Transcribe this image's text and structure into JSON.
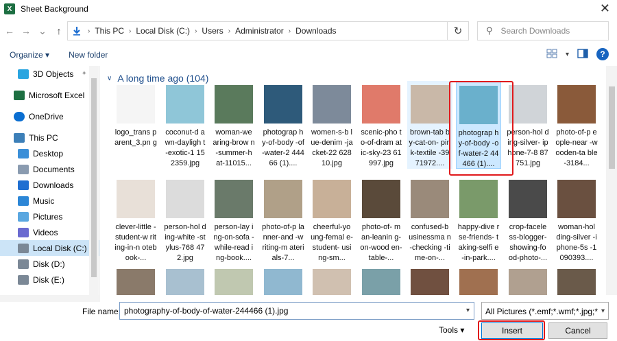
{
  "window": {
    "title": "Sheet Background",
    "app_icon_letter": "X",
    "close_glyph": "✕"
  },
  "nav": {
    "back_glyph": "←",
    "forward_glyph": "→",
    "recent_glyph": "⌄",
    "up_glyph": "↑",
    "breadcrumbs": [
      "This PC",
      "Local Disk (C:)",
      "Users",
      "Administrator",
      "Downloads"
    ],
    "search_placeholder": "Search Downloads",
    "refresh_glyph": "↻"
  },
  "toolbar": {
    "organize_label": "Organize ▾",
    "new_folder_label": "New folder",
    "help_glyph": "?"
  },
  "sidebar": {
    "items": [
      {
        "label": "3D Objects",
        "icon": "cube-icon",
        "color": "#2aa5e0",
        "pinned": true
      },
      {
        "label": "Microsoft Excel",
        "icon": "excel-icon",
        "color": "#1d6f42",
        "root": true
      },
      {
        "label": "OneDrive",
        "icon": "cloud-icon",
        "color": "#0a6ed1",
        "root": true
      },
      {
        "label": "This PC",
        "icon": "computer-icon",
        "color": "#3c7fb8",
        "root": true
      },
      {
        "label": "Desktop",
        "icon": "desktop-icon",
        "color": "#3b8fd8"
      },
      {
        "label": "Documents",
        "icon": "documents-icon",
        "color": "#8a9bb0"
      },
      {
        "label": "Downloads",
        "icon": "downloads-icon",
        "color": "#1f6fd1"
      },
      {
        "label": "Music",
        "icon": "music-icon",
        "color": "#2c86d6"
      },
      {
        "label": "Pictures",
        "icon": "pictures-icon",
        "color": "#5aa7e0"
      },
      {
        "label": "Videos",
        "icon": "videos-icon",
        "color": "#6a6ad0"
      },
      {
        "label": "Local Disk (C:)",
        "icon": "drive-icon",
        "color": "#7b8896",
        "selected": true
      },
      {
        "label": "Disk (D:)",
        "icon": "drive-icon",
        "color": "#7b8896"
      },
      {
        "label": "Disk (E:)",
        "icon": "drive-icon",
        "color": "#7b8896"
      }
    ],
    "pin_glyph": "📌"
  },
  "group": {
    "title": "A long time ago (104)",
    "chevron": "∨"
  },
  "files": {
    "row1": [
      {
        "label": "logo_trans parent_3.pn g",
        "thumb": "#f5f5f5"
      },
      {
        "label": "coconut-d awn-dayligh t-exotic-1 152359.jpg",
        "thumb": "#8fc6d8"
      },
      {
        "label": "woman-we aring-brow n-summer-h at-11015...",
        "thumb": "#5a7a5c"
      },
      {
        "label": "photograp hy-of-body -of-water-2 44466 (1)....",
        "thumb": "#2e5a7a"
      },
      {
        "label": "women-s-b lue-denim -jacket-22 62810.jpg",
        "thumb": "#7d8a9a"
      },
      {
        "label": "scenic-pho to-of-dram atic-sky-23 61997.jpg",
        "thumb": "#e07a6a"
      },
      {
        "label": "brown-tab by-cat-on- pink-textile -3971972....",
        "thumb": "#c9b8a8",
        "selected_bg": true
      },
      {
        "label": "photograp hy-of-body -of-water-2 44466 (1)....",
        "thumb": "#6ab0cc",
        "selected": true
      },
      {
        "label": "person-hol ding-silver- iphone-7-8 87751.jpg",
        "thumb": "#d0d4d8"
      },
      {
        "label": "photo-of-p eople-near -wooden-ta ble-3184...",
        "thumb": "#8a5a3a"
      }
    ],
    "row2": [
      {
        "label": "clever-little -student-w riting-in-n otebook-...",
        "thumb": "#e8e0d8"
      },
      {
        "label": "person-hol ding-white -stylus-768 472.jpg",
        "thumb": "#dcdcdc"
      },
      {
        "label": "person-lay ing-on-sofa -while-read ing-book....",
        "thumb": "#6a7a6a"
      },
      {
        "label": "photo-of-p lanner-and -writing-m aterials-7...",
        "thumb": "#b0a088"
      },
      {
        "label": "cheerful-yo ung-femal e-student- using-sm...",
        "thumb": "#c8b098"
      },
      {
        "label": "photo-of- man-leanin g-on-wood en-table-...",
        "thumb": "#5a4a3a"
      },
      {
        "label": "confused-b usinessma n-checking -time-on-...",
        "thumb": "#9a8a7a"
      },
      {
        "label": "happy-dive rse-friends- taking-selfi e-in-park....",
        "thumb": "#7a9a6a"
      },
      {
        "label": "crop-facele ss-blogger- showing-fo od-photo-...",
        "thumb": "#4a4a4a"
      },
      {
        "label": "woman-hol ding-silver -iphone-5s -1090393....",
        "thumb": "#6a5040"
      }
    ],
    "row3": [
      {
        "label": "",
        "thumb": "#8a7a6a"
      },
      {
        "label": "",
        "thumb": "#a8c0d0"
      },
      {
        "label": "",
        "thumb": "#c0c8b0"
      },
      {
        "label": "",
        "thumb": "#90b8d0"
      },
      {
        "label": "",
        "thumb": "#d0c0b0"
      },
      {
        "label": "",
        "thumb": "#7aa0a8"
      },
      {
        "label": "",
        "thumb": "#705040"
      },
      {
        "label": "",
        "thumb": "#a07050"
      },
      {
        "label": "",
        "thumb": "#b0a090"
      },
      {
        "label": "",
        "thumb": "#6a5a4a"
      }
    ]
  },
  "footer": {
    "filename_label": "File name:",
    "filename_value": "photography-of-body-of-water-244466 (1).jpg",
    "filter_value": "All Pictures (*.emf;*.wmf;*.jpg;*",
    "tools_label": "Tools ▾",
    "insert_label": "Insert",
    "cancel_label": "Cancel"
  },
  "highlight_color": "#e0191b"
}
